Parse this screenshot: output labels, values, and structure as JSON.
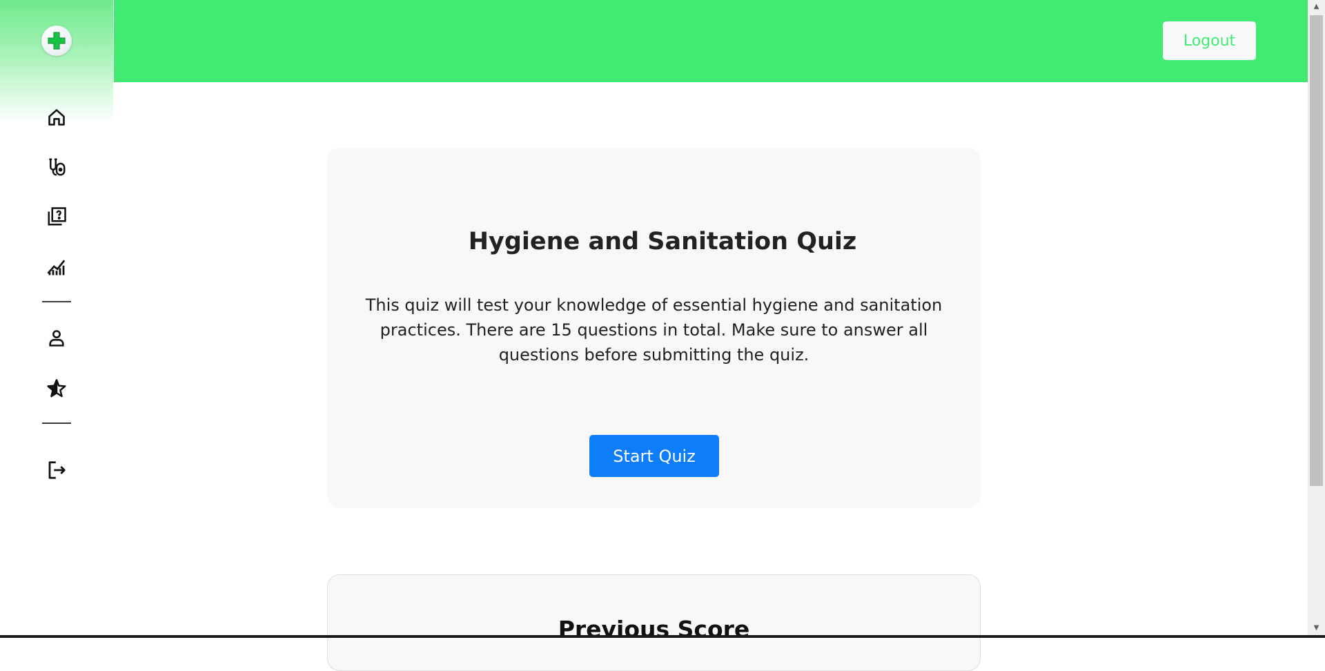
{
  "colors": {
    "brand_green": "#41eb71",
    "primary_blue": "#0d7df9",
    "card_bg": "#f8f8f8"
  },
  "sidebar": {
    "logo_icon": "green-cross-icon",
    "items": [
      {
        "icon": "home-icon"
      },
      {
        "icon": "stethoscope-icon"
      },
      {
        "icon": "quiz-icon"
      },
      {
        "icon": "chart-icon"
      },
      {
        "icon": "profile-icon"
      },
      {
        "icon": "star-icon"
      },
      {
        "icon": "logout-icon"
      }
    ]
  },
  "header": {
    "logout_label": "Logout"
  },
  "quiz": {
    "title": "Hygiene and Sanitation Quiz",
    "description": "This quiz will test your knowledge of essential hygiene and sanitation practices. There are 15 questions in total. Make sure to answer all questions before submitting the quiz.",
    "start_label": "Start Quiz"
  },
  "previous_score": {
    "title": "Previous Score"
  }
}
